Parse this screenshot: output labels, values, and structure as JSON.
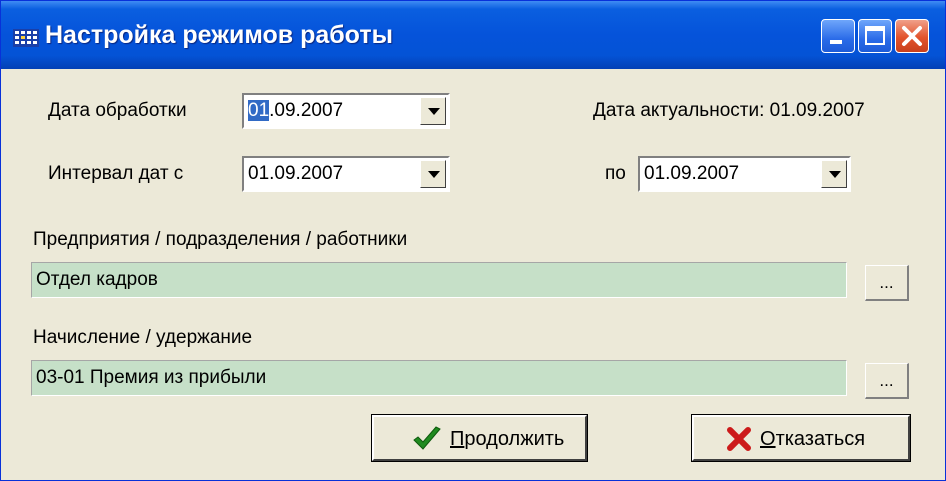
{
  "window": {
    "title": "Настройка режимов работы",
    "icons": {
      "app": "app-grid-icon",
      "minimize": "minimize-icon",
      "maximize": "maximize-icon",
      "close": "close-icon"
    }
  },
  "processing_date": {
    "label": "Дата обработки",
    "value_selected": "01",
    "value_rest": ".09.2007"
  },
  "actuality_date": {
    "text": "Дата актуальности: 01.09.2007"
  },
  "date_interval": {
    "label": "Интервал дат с",
    "from": "01.09.2007",
    "to_label": "по",
    "to": "01.09.2007"
  },
  "organization": {
    "label": "Предприятия / подразделения / работники",
    "value": "Отдел кадров",
    "browse_label": "..."
  },
  "accrual": {
    "label": "Начисление / удержание",
    "value": "03-01  Премия из прибыли",
    "browse_label": "..."
  },
  "buttons": {
    "continue_accel": "П",
    "continue_rest": "родолжить",
    "cancel_accel": "О",
    "cancel_rest": "тказаться"
  },
  "colors": {
    "field_bg": "#c6e0c8",
    "titlebar": "#0553da",
    "window_bg": "#ece9d8"
  }
}
